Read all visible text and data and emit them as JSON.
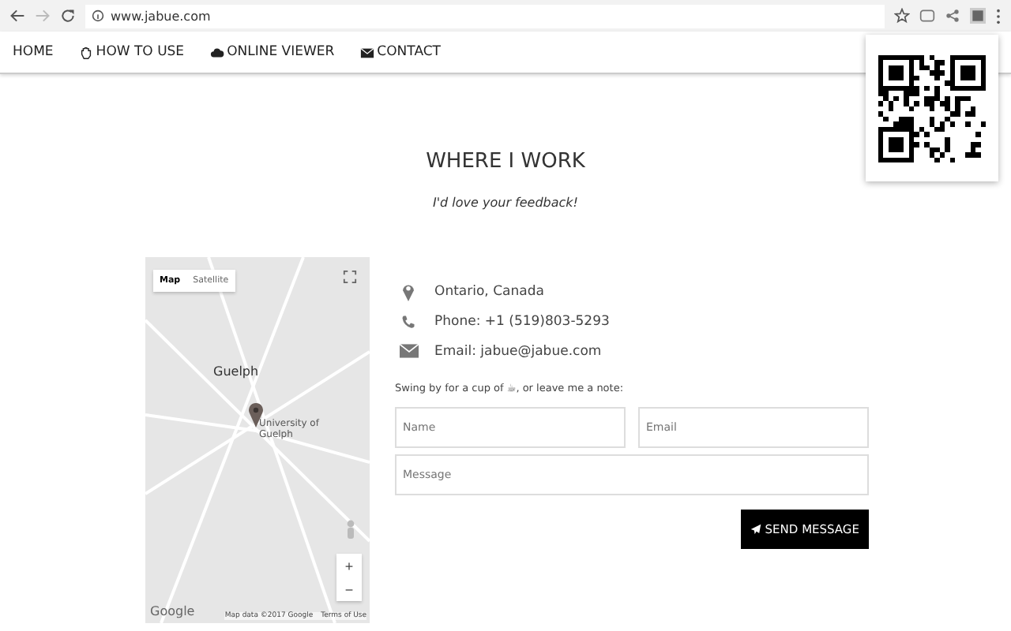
{
  "browser": {
    "url": "www.jabue.com"
  },
  "nav": [
    {
      "label": "HOME",
      "kind": "plain"
    },
    {
      "label": "HOW TO USE",
      "kind": "hand"
    },
    {
      "label": "ONLINE VIEWER",
      "kind": "cloud"
    },
    {
      "label": "CONTACT",
      "kind": "envelope"
    }
  ],
  "heading": "WHERE I WORK",
  "subheading": "I'd love your feedback!",
  "map": {
    "tabs": [
      {
        "label": "Map",
        "selected": true
      },
      {
        "label": "Satellite",
        "selected": false
      }
    ],
    "city": "Guelph",
    "place": "University of Guelph",
    "zoom_in": "+",
    "zoom_out": "−",
    "logo": "Google",
    "attribution": "Map data ©2017 Google",
    "terms": "Terms of Use"
  },
  "contact": [
    {
      "kind": "location",
      "text": "Ontario, Canada"
    },
    {
      "kind": "phone",
      "text": "Phone: +1 (519)803-5293"
    },
    {
      "kind": "email",
      "text": "Email: jabue@jabue.com"
    }
  ],
  "note": "Swing by for a cup of ☕, or leave me a note:",
  "form": {
    "name_placeholder": "Name",
    "email_placeholder": "Email",
    "message_placeholder": "Message",
    "submit": "SEND MESSAGE"
  }
}
